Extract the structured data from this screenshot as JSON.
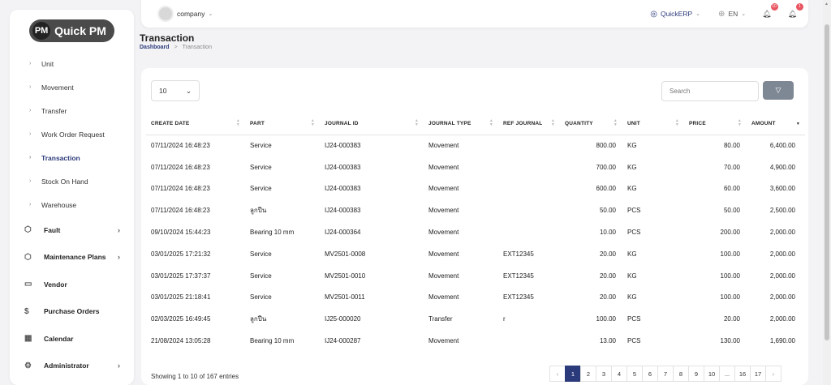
{
  "sidebar": {
    "logo": {
      "badge": "PM",
      "text": "Quick PM"
    },
    "sub_items": [
      {
        "label": "Unit",
        "active": false
      },
      {
        "label": "Movement",
        "active": false
      },
      {
        "label": "Transfer",
        "active": false
      },
      {
        "label": "Work Order Request",
        "active": false
      },
      {
        "label": "Transaction",
        "active": true
      },
      {
        "label": "Stock On Hand",
        "active": false
      },
      {
        "label": "Warehouse",
        "active": false
      }
    ],
    "main_items": [
      {
        "label": "Fault",
        "icon": "cube-icon",
        "glyph": "⬡",
        "chevron": true
      },
      {
        "label": "Maintenance Plans",
        "icon": "cube-icon",
        "glyph": "⬡",
        "chevron": true
      },
      {
        "label": "Vendor",
        "icon": "card-icon",
        "glyph": "▭",
        "chevron": false
      },
      {
        "label": "Purchase Orders",
        "icon": "dollar-icon",
        "glyph": "$",
        "chevron": false
      },
      {
        "label": "Calendar",
        "icon": "calendar-icon",
        "glyph": "▦",
        "chevron": false
      },
      {
        "label": "Administrator",
        "icon": "settings-icon",
        "glyph": "⚙",
        "chevron": true
      }
    ]
  },
  "topbar": {
    "company": "company",
    "app": "QuickERP",
    "language": "EN",
    "notifications_count": "10",
    "alerts_count": "1"
  },
  "page": {
    "title": "Transaction",
    "breadcrumb_home": "Dashboard",
    "breadcrumb_sep": ">",
    "breadcrumb_current": "Transaction"
  },
  "controls": {
    "page_size": "10",
    "search_placeholder": "Search"
  },
  "table": {
    "columns": [
      "CREATE DATE",
      "PART",
      "JOURNAL ID",
      "JOURNAL TYPE",
      "REF JOURNAL",
      "QUANTITY",
      "UNIT",
      "PRICE",
      "AMOUNT"
    ],
    "rows": [
      [
        "07/11/2024 16:48:23",
        "Service",
        "IJ24-000383",
        "Movement",
        "",
        "800.00",
        "KG",
        "80.00",
        "6,400.00"
      ],
      [
        "07/11/2024 16:48:23",
        "Service",
        "IJ24-000383",
        "Movement",
        "",
        "700.00",
        "KG",
        "70.00",
        "4,900.00"
      ],
      [
        "07/11/2024 16:48:23",
        "Service",
        "IJ24-000383",
        "Movement",
        "",
        "600.00",
        "KG",
        "60.00",
        "3,600.00"
      ],
      [
        "07/11/2024 16:48:23",
        "ลูกปืน",
        "IJ24-000383",
        "Movement",
        "",
        "50.00",
        "PCS",
        "50.00",
        "2,500.00"
      ],
      [
        "09/10/2024 15:44:23",
        "Bearing 10 mm",
        "IJ24-000364",
        "Movement",
        "",
        "10.00",
        "PCS",
        "200.00",
        "2,000.00"
      ],
      [
        "03/01/2025 17:21:32",
        "Service",
        "MV2501-0008",
        "Movement",
        "EXT12345",
        "20.00",
        "KG",
        "100.00",
        "2,000.00"
      ],
      [
        "03/01/2025 17:37:37",
        "Service",
        "MV2501-0010",
        "Movement",
        "EXT12345",
        "20.00",
        "KG",
        "100.00",
        "2,000.00"
      ],
      [
        "03/01/2025 21:18:41",
        "Service",
        "MV2501-0011",
        "Movement",
        "EXT12345",
        "20.00",
        "KG",
        "100.00",
        "2,000.00"
      ],
      [
        "02/03/2025 16:49:45",
        "ลูกปืน",
        "IJ25-000020",
        "Transfer",
        "r",
        "100.00",
        "PCS",
        "20.00",
        "2,000.00"
      ],
      [
        "21/08/2024 13:05:28",
        "Bearing 10 mm",
        "IJ24-000287",
        "Movement",
        "",
        "13.00",
        "PCS",
        "130.00",
        "1,690.00"
      ]
    ]
  },
  "footer": {
    "info": "Showing 1 to 10 of 167 entries"
  },
  "pagination": {
    "prev": "‹",
    "next": "›",
    "pages": [
      "1",
      "2",
      "3",
      "4",
      "5",
      "6",
      "7",
      "8",
      "9",
      "10",
      "...",
      "16",
      "17"
    ],
    "active": "1"
  },
  "colors": {
    "accent": "#2b3a7a",
    "filter_button": "#7e8894",
    "badge": "#e8545f"
  }
}
